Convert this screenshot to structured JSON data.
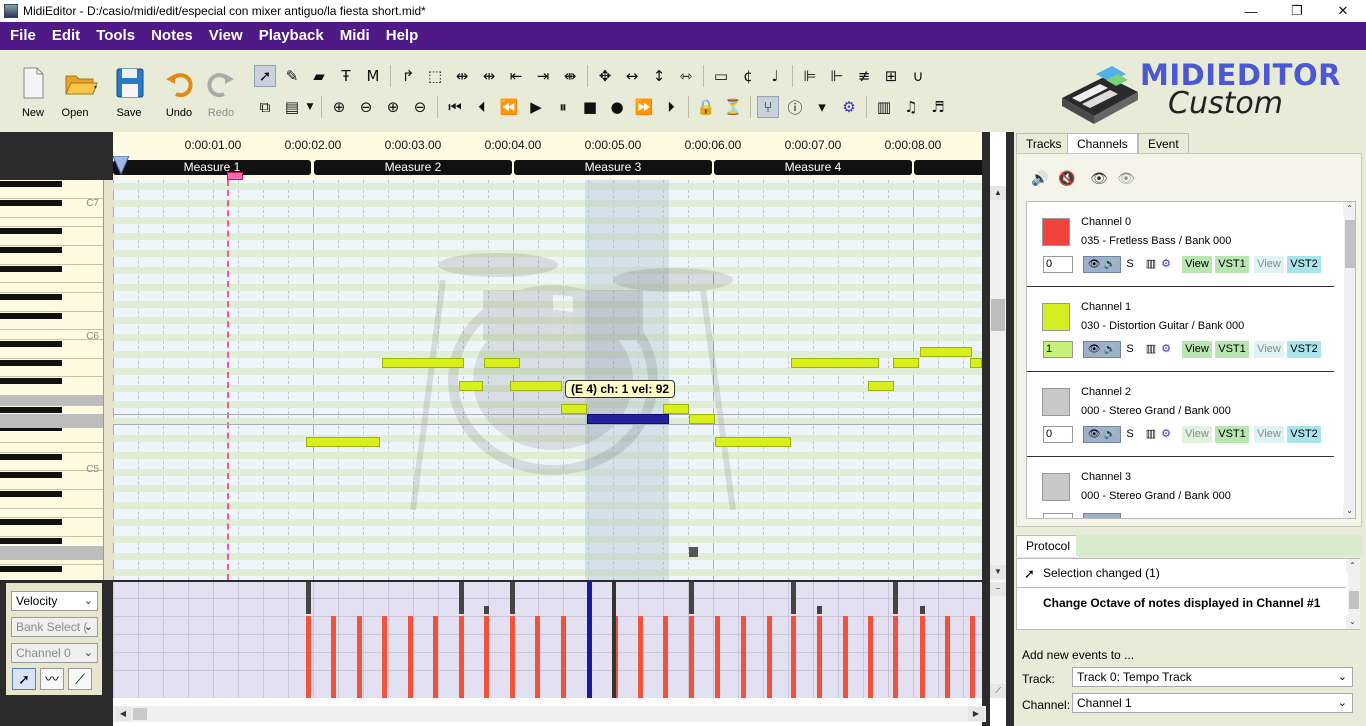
{
  "window": {
    "title": "MidiEditor - D:/casio/midi/edit/especial con mixer antiguo/la fiesta short.mid*",
    "controls": {
      "minimize": "—",
      "maximize": "❐",
      "close": "✕"
    }
  },
  "menu": [
    "File",
    "Edit",
    "Tools",
    "Notes",
    "View",
    "Playback",
    "Midi",
    "Help"
  ],
  "toolbar": {
    "new": "New",
    "open": "Open",
    "save": "Save",
    "undo": "Undo",
    "redo": "Redo"
  },
  "logo": {
    "word1": "MIDIEDITOR",
    "word2": "Custom"
  },
  "ruler": {
    "times": [
      "0:00:01.00",
      "0:00:02.00",
      "0:00:03.00",
      "0:00:04.00",
      "0:00:05.00",
      "0:00:06.00",
      "0:00:07.00",
      "0:00:08.00"
    ],
    "measures": [
      "Measure 1",
      "Measure 2",
      "Measure 3",
      "Measure 4",
      ""
    ]
  },
  "piano": {
    "labels": [
      "C7",
      "C6",
      "C5"
    ]
  },
  "tooltip": "(E 4) ch: 1 vel: 92",
  "velocity_panel": {
    "event_select": "Velocity",
    "controller_select": "Bank Select (",
    "channel_select": "Channel 0"
  },
  "right_tabs": [
    "Tracks",
    "Channels",
    "Event"
  ],
  "channels": [
    {
      "name": "Channel 0",
      "instrument": "035 - Fretless Bass / Bank 000",
      "color": "#f0443c",
      "spin": "0",
      "s": "S",
      "view1": "View",
      "vst1": "VST1",
      "view2": "View",
      "vst2": "VST2"
    },
    {
      "name": "Channel 1",
      "instrument": "030 - Distortion Guitar / Bank 000",
      "color": "#d6ef22",
      "spin": "1",
      "s": "S",
      "view1": "View",
      "vst1": "VST1",
      "view2": "View",
      "vst2": "VST2"
    },
    {
      "name": "Channel 2",
      "instrument": "000 - Stereo Grand / Bank 000",
      "color": "#c8c8c8",
      "spin": "0",
      "s": "S",
      "view1": "View",
      "vst1": "VST1",
      "view2": "View",
      "vst2": "VST2"
    },
    {
      "name": "Channel 3",
      "instrument": "000 - Stereo Grand / Bank 000",
      "color": "#c8c8c8",
      "spin": "",
      "s": "",
      "view1": "",
      "vst1": "",
      "view2": "",
      "vst2": ""
    }
  ],
  "protocol": {
    "tab": "Protocol",
    "items": [
      "Selection changed (1)",
      "Change Octave of notes displayed in Channel #1"
    ]
  },
  "add_events": {
    "title": "Add new events to ...",
    "track_label": "Track:",
    "track_value": "Track 0: Tempo Track",
    "channel_label": "Channel:",
    "channel_value": "Channel 1"
  },
  "colors": {
    "menubar": "#4f1a86",
    "note": "#d9ef1c",
    "selected_note": "#23239a",
    "velocity": "#f0533c",
    "playhead": "#ff4fa8"
  }
}
